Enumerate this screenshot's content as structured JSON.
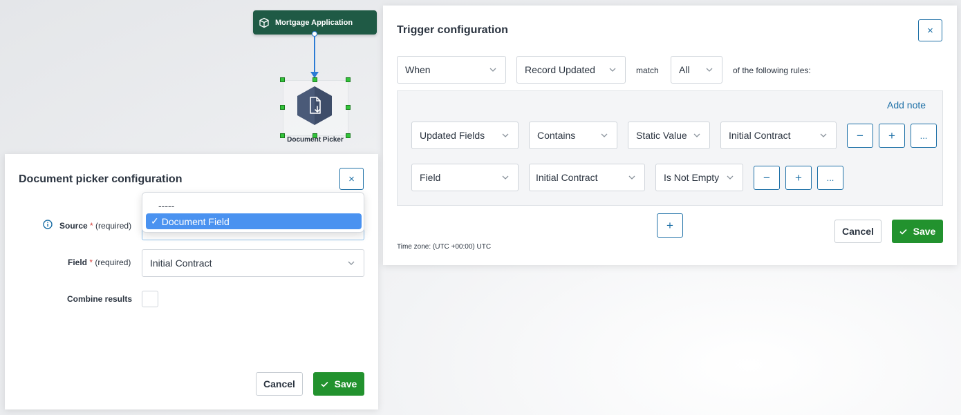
{
  "canvas": {
    "start_node_label": "Mortgage Application",
    "picker_node_label": "Document Picker"
  },
  "trigger": {
    "title": "Trigger configuration",
    "close_glyph": "×",
    "when_value": "When",
    "event_value": "Record Updated",
    "match_label": "match",
    "match_value": "All",
    "rules_suffix": "of the following rules:",
    "add_note_label": "Add note",
    "rules": [
      {
        "fields": [
          "Updated Fields",
          "Contains",
          "Static Value",
          "Initial Contract"
        ]
      },
      {
        "fields": [
          "Field",
          "Initial Contract",
          "Is Not Empty"
        ]
      }
    ],
    "minus_glyph": "−",
    "plus_glyph": "+",
    "more_glyph": "...",
    "timezone_label": "Time zone:",
    "timezone_value": "(UTC +00:00) UTC",
    "cancel_label": "Cancel",
    "save_label": "Save"
  },
  "picker": {
    "title": "Document picker configuration",
    "close_glyph": "×",
    "source_label": "Source",
    "required_star": "*",
    "required_text": "(required)",
    "field_label": "Field",
    "field_value": "Initial Contract",
    "combine_label": "Combine results",
    "source_options": [
      {
        "label": "-----",
        "selected": false
      },
      {
        "label": "Document Field",
        "selected": true
      }
    ],
    "selected_check": "✓",
    "cancel_label": "Cancel",
    "save_label": "Save"
  },
  "colors": {
    "accent": "#1c6fa6",
    "save_green": "#22922e",
    "node_green": "#1f5a45",
    "node_hex": "#4a5a78",
    "handle_green": "#32c33a",
    "selection_blue": "#4a92f0"
  }
}
